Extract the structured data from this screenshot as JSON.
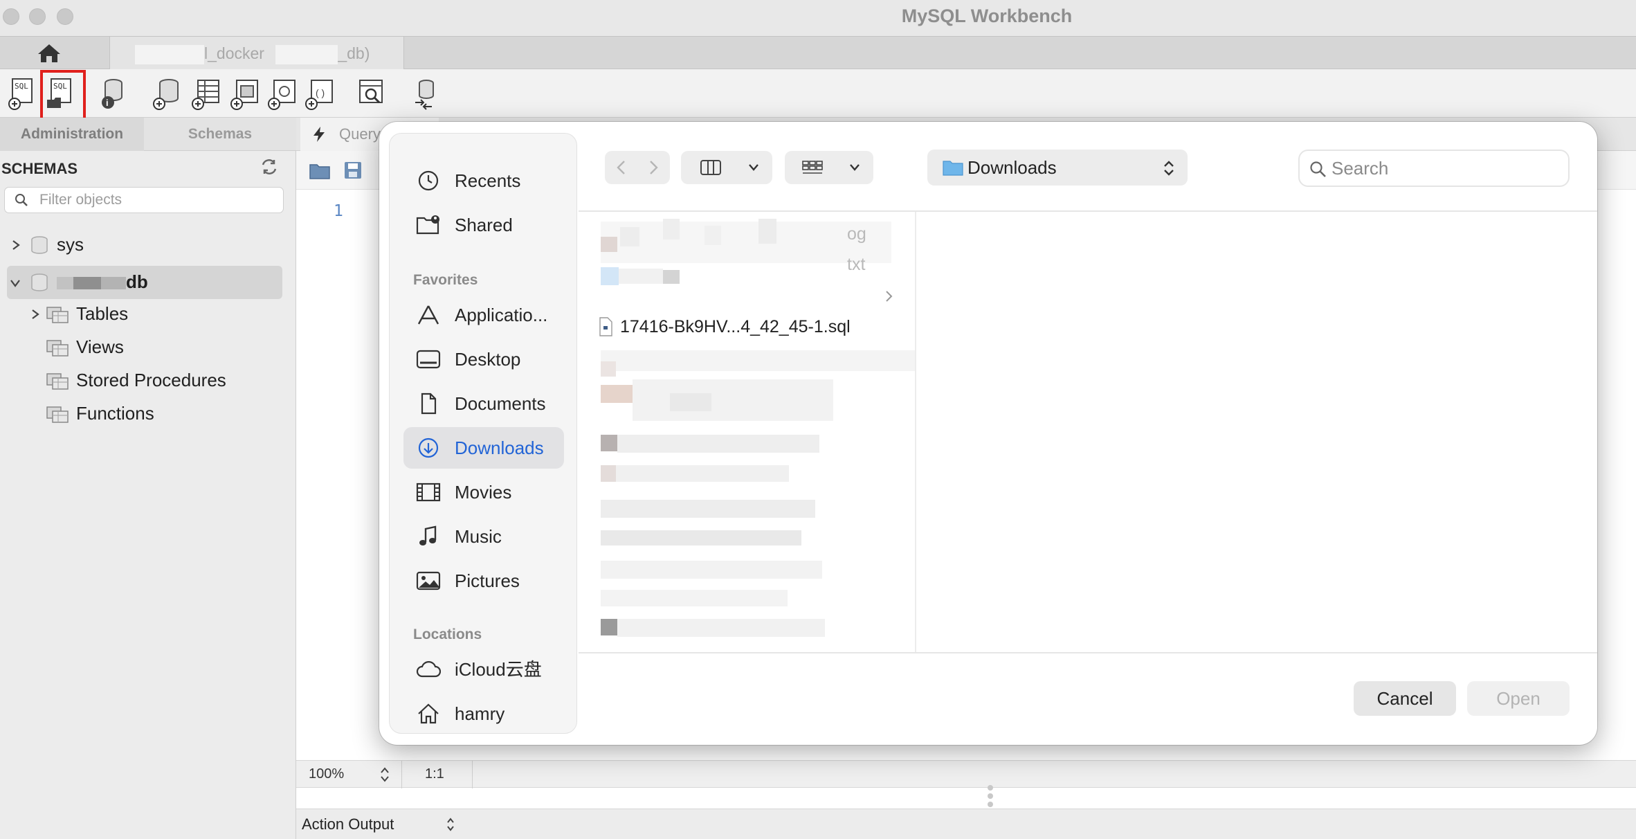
{
  "window": {
    "title": "MySQL Workbench"
  },
  "tabs": {
    "connection_label": "l_docker",
    "connection_suffix": "_db)"
  },
  "sidebar": {
    "tabs": [
      "Administration",
      "Schemas"
    ],
    "header": "SCHEMAS",
    "filter_placeholder": "Filter objects",
    "tree": {
      "sys": "sys",
      "db": "db",
      "children": [
        "Tables",
        "Views",
        "Stored Procedures",
        "Functions"
      ]
    }
  },
  "editor": {
    "tab_label": "Query",
    "line_number": "1",
    "zoom": "100%",
    "cursor_pos": "1:1",
    "output_label": "Action Output"
  },
  "dialog": {
    "sidebar": {
      "recents": "Recents",
      "shared": "Shared",
      "favorites_header": "Favorites",
      "favorites": [
        "Applicatio...",
        "Desktop",
        "Documents",
        "Downloads",
        "Movies",
        "Music",
        "Pictures"
      ],
      "selected": "Downloads",
      "locations_header": "Locations",
      "locations": [
        "iCloud云盘",
        "hamry"
      ]
    },
    "location": "Downloads",
    "search_placeholder": "Search",
    "files": {
      "partial_1": "og",
      "partial_2": "txt",
      "sql_file": "17416-Bk9HV...4_42_45-1.sql"
    },
    "buttons": {
      "cancel": "Cancel",
      "open": "Open"
    }
  },
  "colors": {
    "accent": "#2264d6",
    "highlight_box": "#e0201c"
  }
}
